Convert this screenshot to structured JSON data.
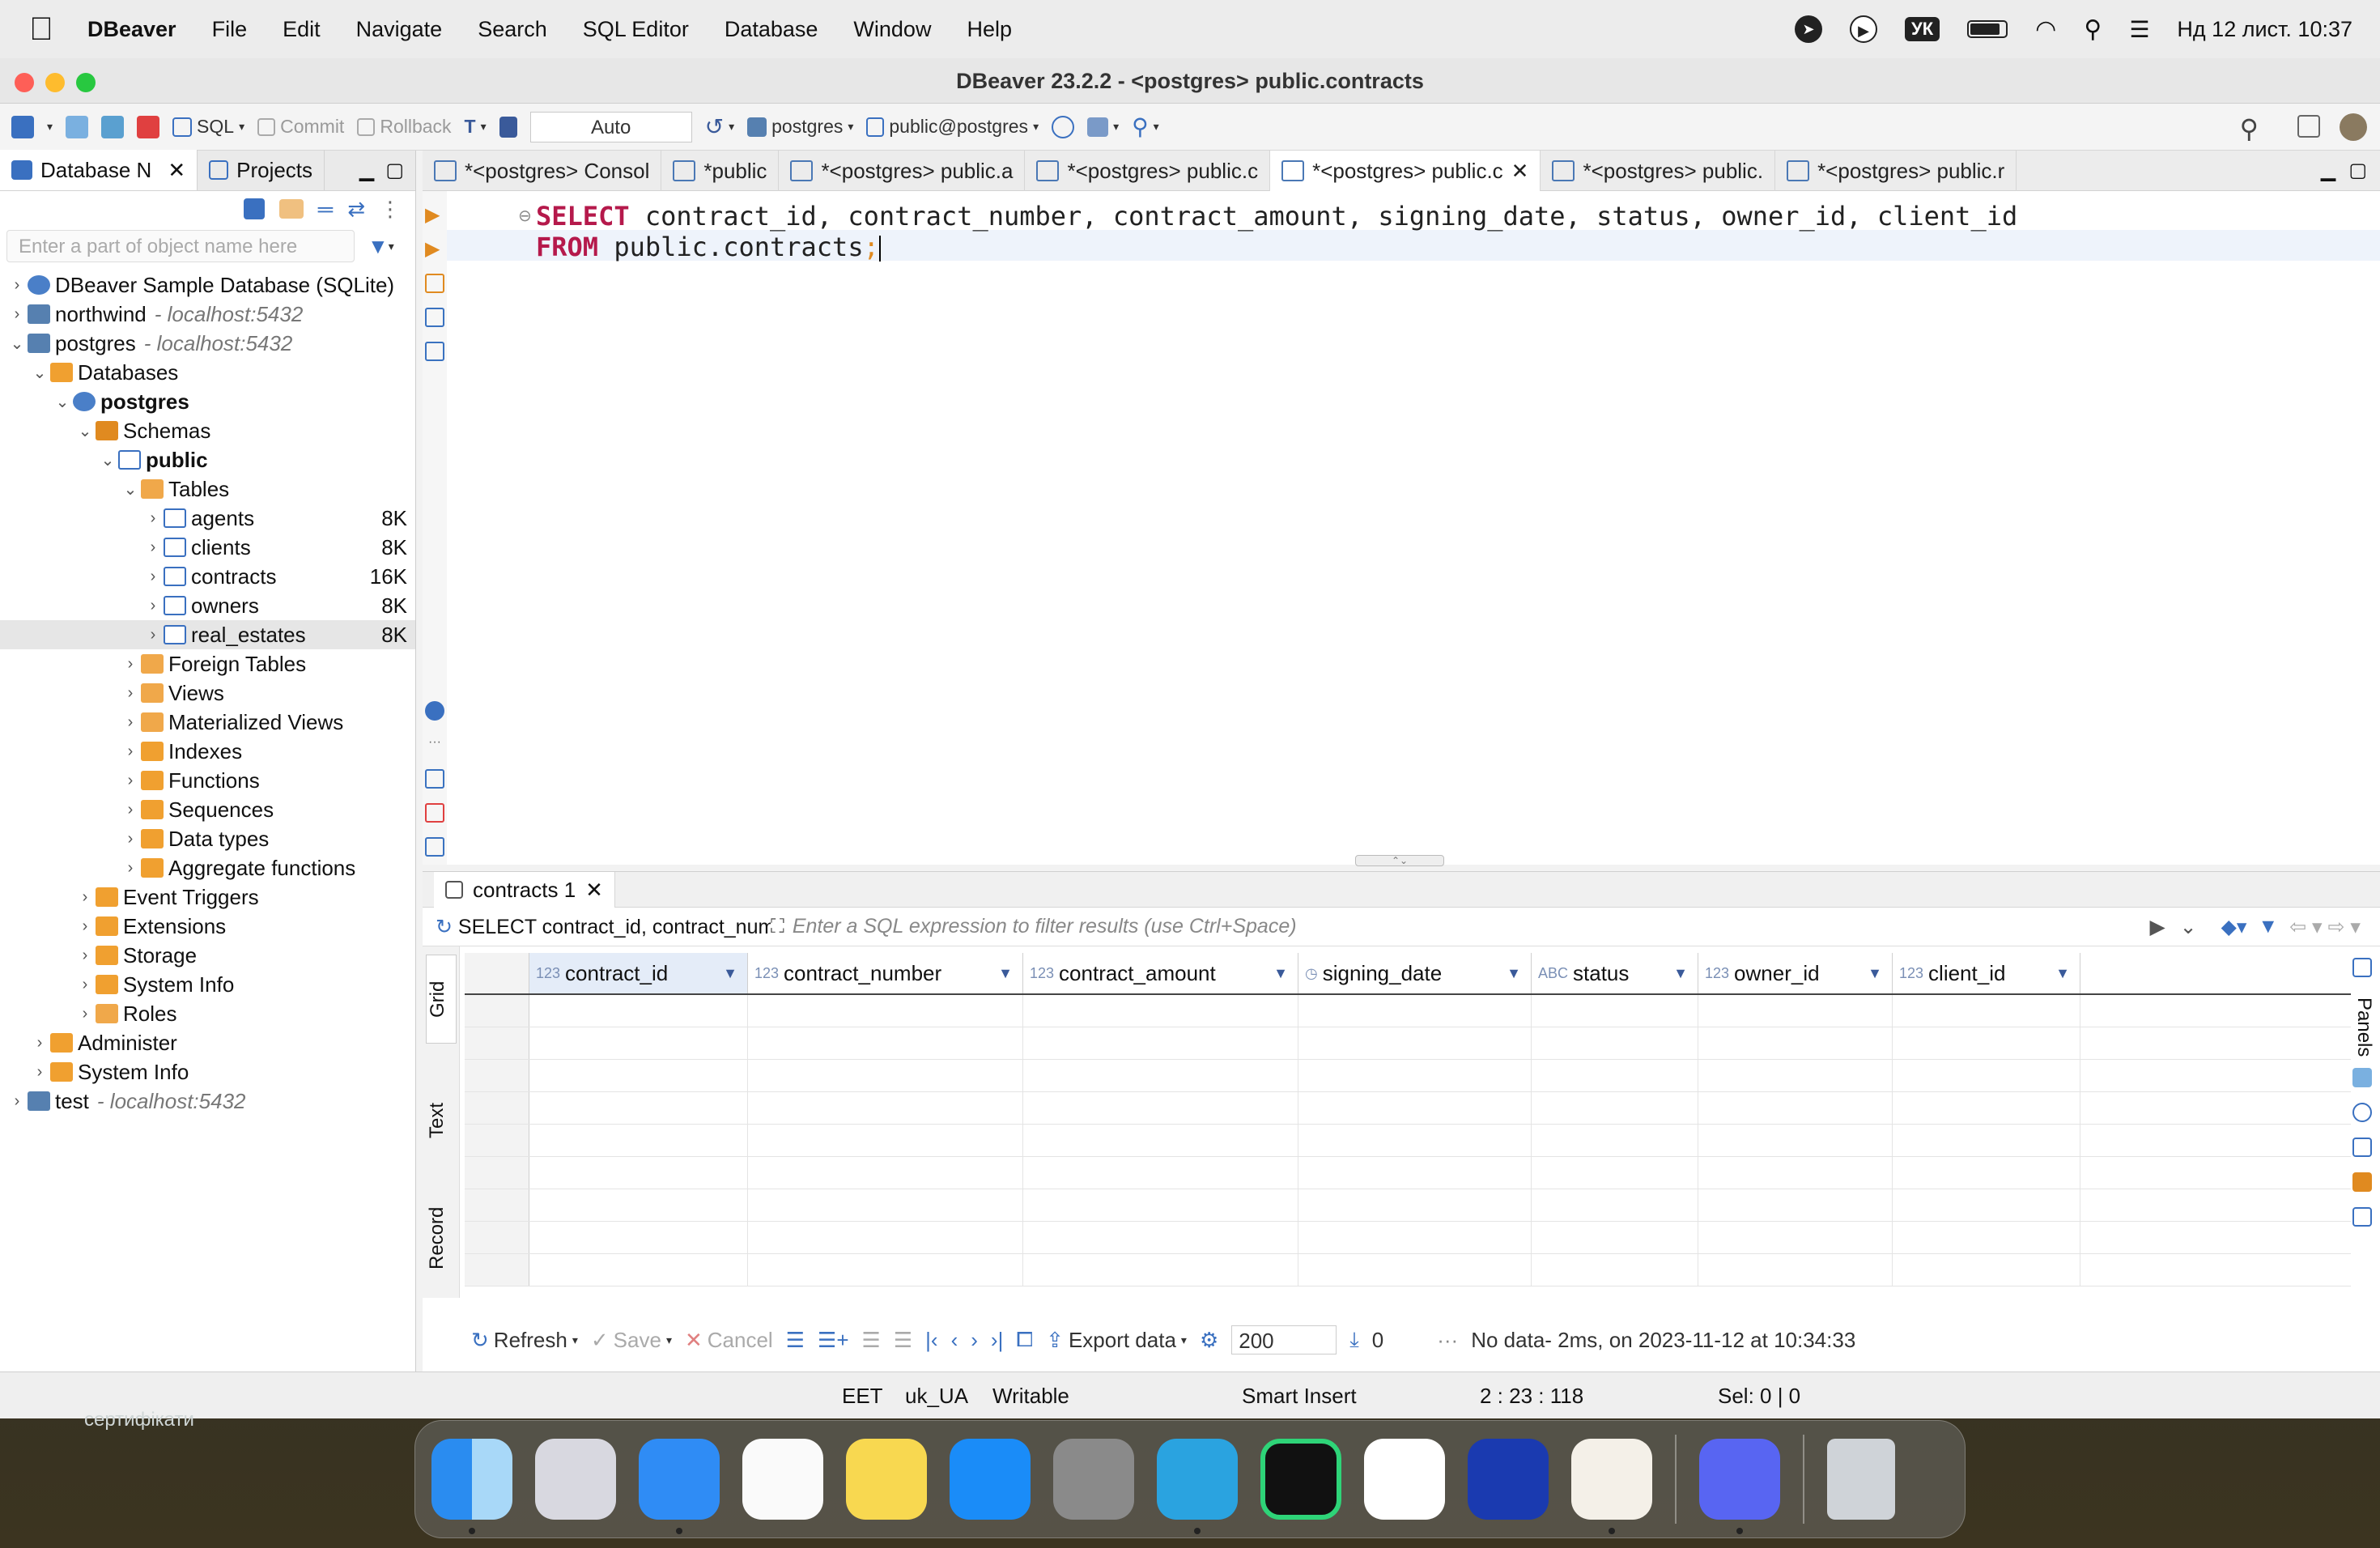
{
  "menubar": {
    "app_name": "DBeaver",
    "items": [
      "File",
      "Edit",
      "Navigate",
      "Search",
      "SQL Editor",
      "Database",
      "Window",
      "Help"
    ],
    "keyboard": "УК",
    "datetime": "Нд 12 лист.  10:37"
  },
  "window": {
    "title": "DBeaver 23.2.2 - <postgres> public.contracts"
  },
  "toolbar": {
    "sql_label": "SQL",
    "commit_label": "Commit",
    "rollback_label": "Rollback",
    "tx_mode": "Auto",
    "datasource": "postgres",
    "schema": "public@postgres"
  },
  "navigator": {
    "tabs": [
      "Database N",
      "Projects"
    ],
    "filter_placeholder": "Enter a part of object name here",
    "tree": [
      {
        "label": "DBeaver Sample Database (SQLite)",
        "sub": "",
        "size": "",
        "level": 0,
        "arrow": "›",
        "icon": "db-sqlite-icon",
        "bold": false
      },
      {
        "label": "northwind",
        "sub": "- localhost:5432",
        "size": "",
        "level": 0,
        "arrow": "›",
        "icon": "postgres-icon",
        "bold": false
      },
      {
        "label": "postgres",
        "sub": "- localhost:5432",
        "size": "",
        "level": 0,
        "arrow": "⌄",
        "icon": "postgres-icon",
        "bold": false
      },
      {
        "label": "Databases",
        "sub": "",
        "size": "",
        "level": 1,
        "arrow": "⌄",
        "icon": "folder-icon",
        "bold": false
      },
      {
        "label": "postgres",
        "sub": "",
        "size": "",
        "level": 2,
        "arrow": "⌄",
        "icon": "database-icon",
        "bold": true
      },
      {
        "label": "Schemas",
        "sub": "",
        "size": "",
        "level": 3,
        "arrow": "⌄",
        "icon": "schemas-icon",
        "bold": false
      },
      {
        "label": "public",
        "sub": "",
        "size": "",
        "level": 4,
        "arrow": "⌄",
        "icon": "schema-icon",
        "bold": true
      },
      {
        "label": "Tables",
        "sub": "",
        "size": "",
        "level": 5,
        "arrow": "⌄",
        "icon": "tables-folder-icon",
        "bold": false
      },
      {
        "label": "agents",
        "sub": "",
        "size": "8K",
        "level": 6,
        "arrow": "›",
        "icon": "table-icon",
        "bold": false
      },
      {
        "label": "clients",
        "sub": "",
        "size": "8K",
        "level": 6,
        "arrow": "›",
        "icon": "table-icon",
        "bold": false
      },
      {
        "label": "contracts",
        "sub": "",
        "size": "16K",
        "level": 6,
        "arrow": "›",
        "icon": "table-icon",
        "bold": false
      },
      {
        "label": "owners",
        "sub": "",
        "size": "8K",
        "level": 6,
        "arrow": "›",
        "icon": "table-icon",
        "bold": false
      },
      {
        "label": "real_estates",
        "sub": "",
        "size": "8K",
        "level": 6,
        "arrow": "›",
        "icon": "table-icon",
        "bold": false,
        "selected": true
      },
      {
        "label": "Foreign Tables",
        "sub": "",
        "size": "",
        "level": 5,
        "arrow": "›",
        "icon": "foreign-tables-icon",
        "bold": false
      },
      {
        "label": "Views",
        "sub": "",
        "size": "",
        "level": 5,
        "arrow": "›",
        "icon": "views-icon",
        "bold": false
      },
      {
        "label": "Materialized Views",
        "sub": "",
        "size": "",
        "level": 5,
        "arrow": "›",
        "icon": "mat-views-icon",
        "bold": false
      },
      {
        "label": "Indexes",
        "sub": "",
        "size": "",
        "level": 5,
        "arrow": "›",
        "icon": "folder-icon",
        "bold": false
      },
      {
        "label": "Functions",
        "sub": "",
        "size": "",
        "level": 5,
        "arrow": "›",
        "icon": "folder-icon",
        "bold": false
      },
      {
        "label": "Sequences",
        "sub": "",
        "size": "",
        "level": 5,
        "arrow": "›",
        "icon": "folder-icon",
        "bold": false
      },
      {
        "label": "Data types",
        "sub": "",
        "size": "",
        "level": 5,
        "arrow": "›",
        "icon": "folder-icon",
        "bold": false
      },
      {
        "label": "Aggregate functions",
        "sub": "",
        "size": "",
        "level": 5,
        "arrow": "›",
        "icon": "folder-icon",
        "bold": false
      },
      {
        "label": "Event Triggers",
        "sub": "",
        "size": "",
        "level": 3,
        "arrow": "›",
        "icon": "folder-icon",
        "bold": false
      },
      {
        "label": "Extensions",
        "sub": "",
        "size": "",
        "level": 3,
        "arrow": "›",
        "icon": "extensions-icon",
        "bold": false
      },
      {
        "label": "Storage",
        "sub": "",
        "size": "",
        "level": 3,
        "arrow": "›",
        "icon": "folder-icon",
        "bold": false
      },
      {
        "label": "System Info",
        "sub": "",
        "size": "",
        "level": 3,
        "arrow": "›",
        "icon": "folder-icon",
        "bold": false
      },
      {
        "label": "Roles",
        "sub": "",
        "size": "",
        "level": 3,
        "arrow": "›",
        "icon": "roles-icon",
        "bold": false
      },
      {
        "label": "Administer",
        "sub": "",
        "size": "",
        "level": 1,
        "arrow": "›",
        "icon": "administer-icon",
        "bold": false
      },
      {
        "label": "System Info",
        "sub": "",
        "size": "",
        "level": 1,
        "arrow": "›",
        "icon": "folder-icon",
        "bold": false
      },
      {
        "label": "test",
        "sub": "- localhost:5432",
        "size": "",
        "level": 0,
        "arrow": "›",
        "icon": "postgres-icon",
        "bold": false
      }
    ]
  },
  "editor": {
    "tabs": [
      {
        "label": "*<postgres> Consol",
        "active": false
      },
      {
        "label": "*public",
        "active": false
      },
      {
        "label": "*<postgres> public.a",
        "active": false
      },
      {
        "label": "*<postgres> public.c",
        "active": false
      },
      {
        "label": "*<postgres> public.c",
        "active": true
      },
      {
        "label": "*<postgres> public.",
        "active": false
      },
      {
        "label": "*<postgres> public.r",
        "active": false
      }
    ],
    "line1_kw": "SELECT",
    "line1_rest": " contract_id, contract_number, contract_amount, signing_date, status, owner_id, client_id",
    "line2_kw": "FROM",
    "line2_rest": " public.contracts",
    "line2_end": ";"
  },
  "results": {
    "tab": "contracts 1",
    "query_preview": "SELECT contract_id, contract_number",
    "filter_placeholder": "Enter a SQL expression to filter results (use Ctrl+Space)",
    "side_tabs": [
      "Grid",
      "Text",
      "Record"
    ],
    "panels_label": "Panels",
    "columns": [
      {
        "type": "123",
        "name": "contract_id"
      },
      {
        "type": "123",
        "name": "contract_number"
      },
      {
        "type": "123",
        "name": "contract_amount"
      },
      {
        "type": "◷",
        "name": "signing_date"
      },
      {
        "type": "ABC",
        "name": "status"
      },
      {
        "type": "123",
        "name": "owner_id"
      },
      {
        "type": "123",
        "name": "client_id"
      }
    ],
    "refresh": "Refresh",
    "save": "Save",
    "cancel": "Cancel",
    "export": "Export data",
    "fetch_size": "200",
    "row_count": "0",
    "status_msg": "No data- 2ms, on 2023-11-12 at 10:34:33"
  },
  "statusbar": {
    "tz": "EET",
    "locale": "uk_UA",
    "mode": "Writable",
    "insert": "Smart Insert",
    "pos": "2 : 23 : 118",
    "sel": "Sel: 0 | 0"
  },
  "desktop": {
    "label": "сертифікати"
  },
  "dock": [
    "finder-icon",
    "launchpad-icon",
    "safari-icon",
    "reminders-icon",
    "notes-icon",
    "app-store-icon",
    "system-settings-icon",
    "telegram-icon",
    "pycharm-icon",
    "vscode-icon",
    "screen-app-icon",
    "dbeaver-icon",
    "discord-icon",
    "trash-icon"
  ],
  "colors": {
    "keyword": "#b5194b",
    "accent": "#3a70c0",
    "folder": "#f0a030"
  }
}
